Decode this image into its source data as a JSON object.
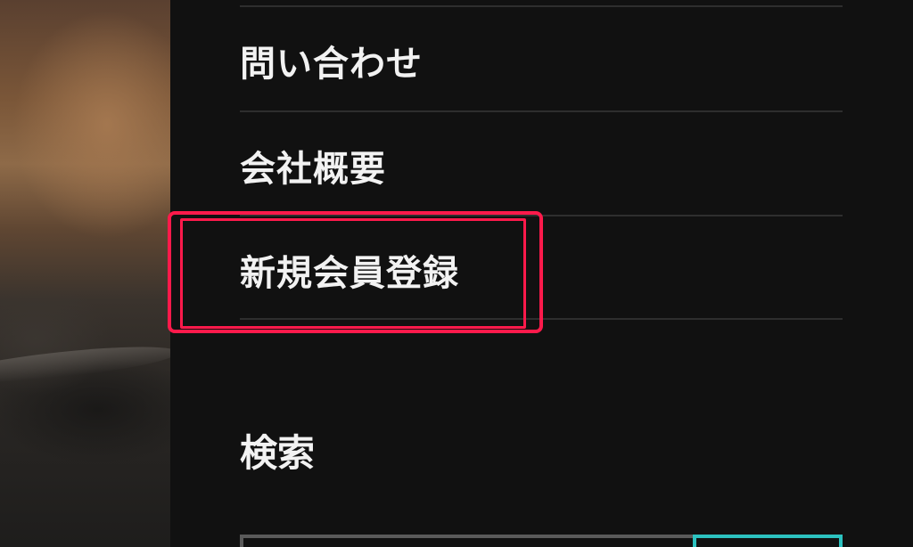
{
  "menu": {
    "items": [
      {
        "label": "問い合わせ"
      },
      {
        "label": "会社概要"
      },
      {
        "label": "新規会員登録",
        "highlighted": true
      }
    ]
  },
  "search": {
    "heading": "検索",
    "placeholder": ""
  },
  "colors": {
    "panel_background": "#111111",
    "text": "#f2f2f2",
    "divider": "#2e2e2e",
    "highlight": "#ff1a4b",
    "search_button_border": "#2cc2c0"
  }
}
